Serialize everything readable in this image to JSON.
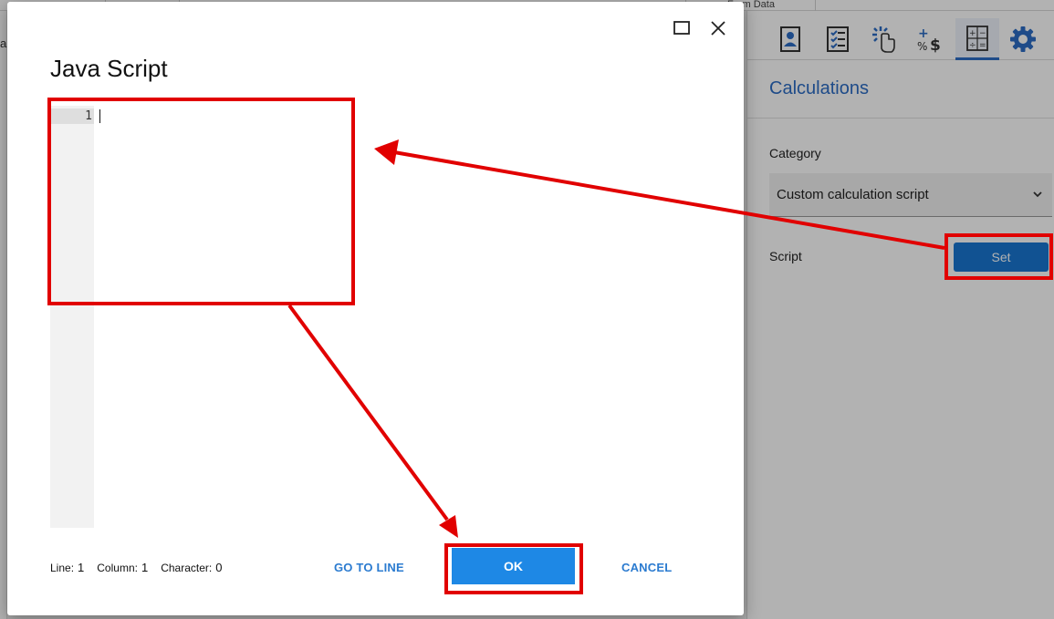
{
  "background": {
    "top_tabs": [
      "Form Data"
    ],
    "left_letter": "a",
    "toolbar_icons": [
      "form-properties-icon",
      "checklist-icon",
      "click-action-icon",
      "calculate-format-icon",
      "calculator-icon",
      "gear-icon"
    ],
    "panel_title": "Calculations",
    "category_label": "Category",
    "category_value": "Custom calculation script",
    "script_label": "Script",
    "set_label": "Set"
  },
  "dialog": {
    "title": "Java Script",
    "line_number": "1",
    "status": {
      "line_label": "Line:",
      "line_value": "1",
      "column_label": "Column:",
      "column_value": "1",
      "character_label": "Character:",
      "character_value": "0"
    },
    "go_to_line_label": "GO TO LINE",
    "ok_label": "OK",
    "cancel_label": "CANCEL"
  },
  "colors": {
    "accent": "#1e88e5",
    "panel_title": "#2b6cc4",
    "highlight": "#e10000"
  }
}
